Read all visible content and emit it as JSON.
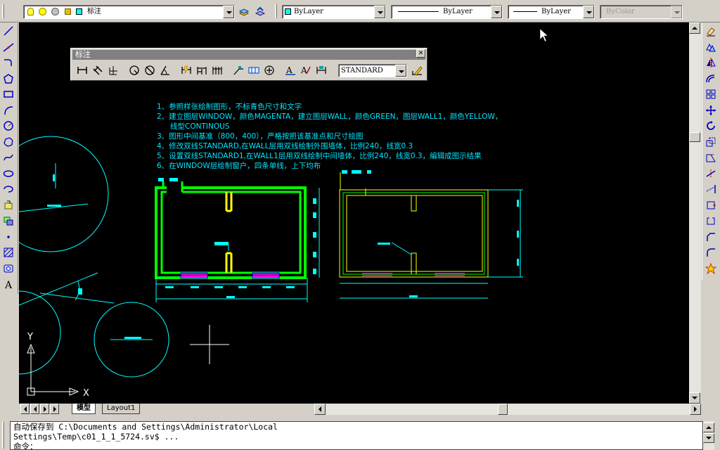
{
  "toolbar": {
    "layer_name": "标注",
    "color": {
      "value": "ByLayer",
      "swatch": "#00ffff"
    },
    "linetype": {
      "value": "ByLayer"
    },
    "lineweight": {
      "value": "ByLayer"
    },
    "plotstyle": {
      "value": "ByColor"
    }
  },
  "dim_toolbar": {
    "title": "标注",
    "style_value": "STANDARD",
    "close_glyph": "✕"
  },
  "drawing": {
    "notes": [
      "1、参照样张绘制图形，不标青色尺寸和文字",
      "2、建立图层WINDOW，颜色MAGENTA，建立图层WALL，颜色GREEN，图层WALL1，颜色YELLOW，",
      "线型CONTINOUS",
      "3、图形中间基准（800，400），严格按照该基准点和尺寸绘图",
      "4、修改双线STANDARD,在WALL层用双线绘制外围墙体，比例240，线宽0.3",
      "5、设置双线STANDARD1,在WALL1层用双线绘制中间墙体，比例240，线宽0.3，编辑成图示结果",
      "6、在WINDOW层绘制窗户，四条单线，上下均布"
    ],
    "ucs_x": "X",
    "ucs_y": "Y",
    "colors": {
      "cyan": "#00ffff",
      "green": "#00ff00",
      "yellow": "#ffff00",
      "magenta": "#ff00ff",
      "text": "#00e5ff",
      "white": "#ffffff"
    }
  },
  "tabs": {
    "model": "模型",
    "layout": "Layout1"
  },
  "command": {
    "line1": "自动保存到 C:\\Documents and Settings\\Administrator\\Local",
    "line2": "Settings\\Temp\\c01_1_1_5724.sv$ ...",
    "line3": "命令："
  }
}
